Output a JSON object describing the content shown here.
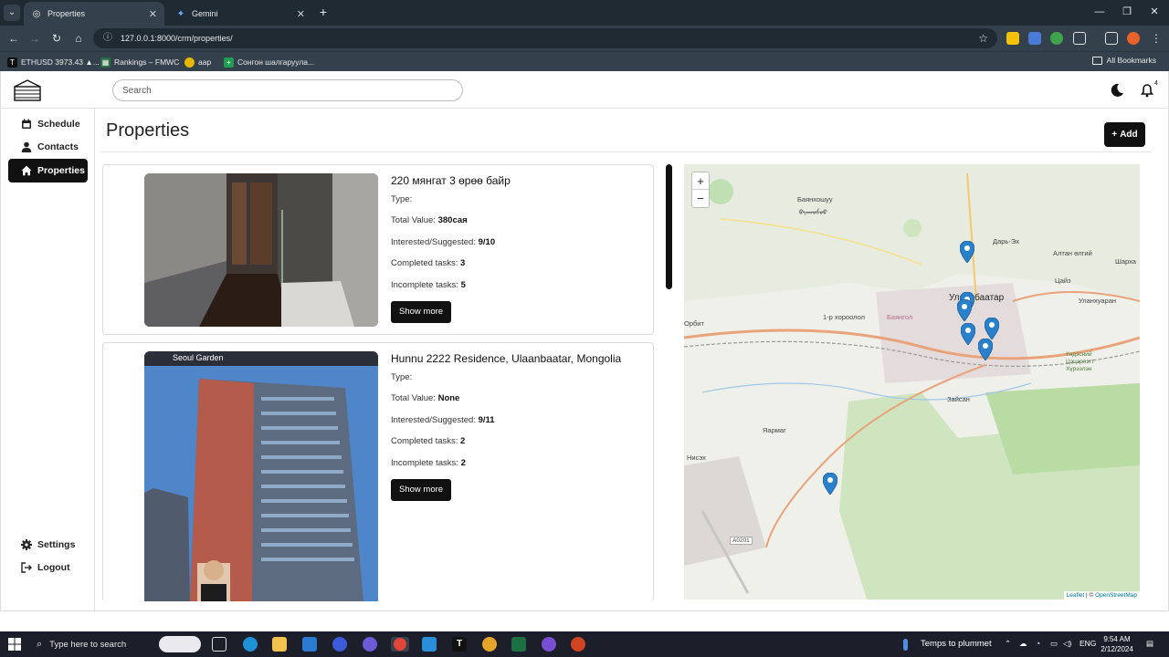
{
  "browser": {
    "tabs": [
      {
        "title": "Properties",
        "active": true,
        "icon": "globe-icon"
      },
      {
        "title": "Gemini",
        "active": false,
        "icon": "gemini-icon"
      }
    ],
    "url": "127.0.0.1:8000/crm/properties/",
    "bookmarks": [
      {
        "label": "ETHUSD 3973.43 ▲...",
        "icon": "tradingview-icon"
      },
      {
        "label": "Rankings – FMWC",
        "icon": "excel-icon"
      },
      {
        "label": "аар",
        "icon": "app-icon"
      },
      {
        "label": "Сонгон шалгаруула...",
        "icon": "sheets-icon"
      }
    ],
    "all_bookmarks": "All Bookmarks"
  },
  "app": {
    "search_placeholder": "Search",
    "notification_count": "4",
    "sidebar": {
      "items": [
        {
          "label": "Schedule",
          "icon": "calendar-icon"
        },
        {
          "label": "Contacts",
          "icon": "person-icon"
        },
        {
          "label": "Properties",
          "icon": "home-icon",
          "active": true
        }
      ],
      "bottom": [
        {
          "label": "Settings",
          "icon": "gear-icon"
        },
        {
          "label": "Logout",
          "icon": "logout-icon"
        }
      ]
    },
    "page_title": "Properties",
    "add_label": "Add",
    "properties": [
      {
        "title": "220 мянгат 3 өрөө байр",
        "type_label": "Type:",
        "type": "",
        "total_value_label": "Total Value:",
        "total_value": "380сая",
        "interested_label": "Interested/Suggested:",
        "interested": "9/10",
        "completed_label": "Completed tasks:",
        "completed": "3",
        "incomplete_label": "Incomplete tasks:",
        "incomplete": "5",
        "button": "Show more"
      },
      {
        "title": "Hunnu 2222 Residence, Ulaanbaatar, Mongolia",
        "type_label": "Type:",
        "type": "",
        "total_value_label": "Total Value:",
        "total_value": "None",
        "interested_label": "Interested/Suggested:",
        "interested": "9/11",
        "completed_label": "Completed tasks:",
        "completed": "2",
        "incomplete_label": "Incomplete tasks:",
        "incomplete": "2",
        "button": "Show more",
        "image_caption": "Seoul Garden"
      }
    ],
    "map": {
      "zoom_in": "+",
      "zoom_out": "−",
      "labels": [
        "Баянхошуу",
        "ᠪᠠᠶᠠᠨᠬᠣᠱᠤᠤ",
        "Дарь-Эх",
        "Алтан өлгий",
        "Шарха",
        "Цайз",
        "Улаанбаатар",
        "Уланхуаран",
        "1-р хороолол",
        "Орбит",
        "Баянгол",
        "Зайсан",
        "Яармаг",
        "Нисэх",
        "Үндэсний Цэцэрлэгт Хүрээлэн",
        "A0201"
      ],
      "attribution_leaflet": "Leaflet",
      "attribution_sep": " | © ",
      "attribution_osm": "OpenStreetMap"
    }
  },
  "taskbar": {
    "search_placeholder": "Type here to search",
    "weather": "Temps to plummet",
    "language": "ENG",
    "time": "9:54 AM",
    "date": "2/12/2024"
  }
}
